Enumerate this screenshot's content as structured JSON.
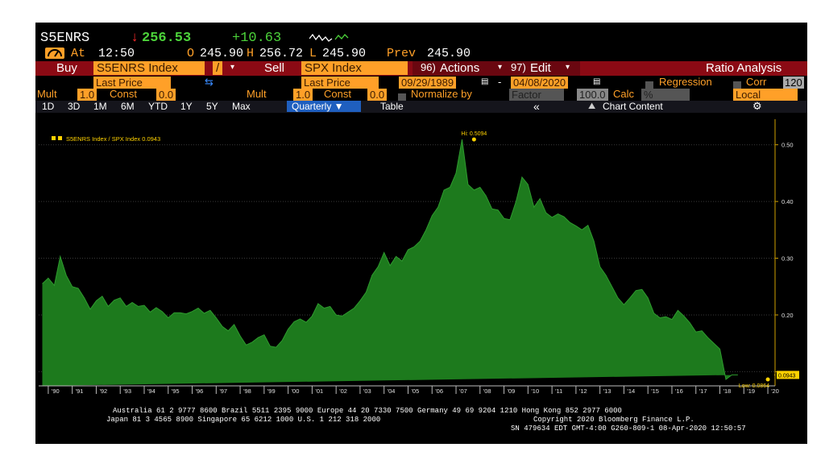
{
  "header": {
    "ticker": "S5ENRS",
    "arrow": "↓",
    "price": "256.53",
    "change": "+10.63",
    "icon_name": "bloomberg-icon",
    "at_label": "At",
    "time": "12:50",
    "open_label": "O",
    "open": "245.90",
    "high_label": "H",
    "high": "256.72",
    "low_label": "L",
    "low": "245.90",
    "prev_label": "Prev",
    "prev": "245.90"
  },
  "toolbar": {
    "buy_label": "Buy",
    "buy_security": "S5ENRS Index",
    "operator": "/",
    "sell_label": "Sell",
    "sell_security": "SPX Index",
    "actions_num": "96)",
    "actions_label": "Actions",
    "edit_num": "97)",
    "edit_label": "Edit",
    "title": "Ratio Analysis"
  },
  "params": {
    "buy_field": "Last Price",
    "sell_field": "Last Price",
    "start_date": "09/29/1989",
    "date_sep": "-",
    "end_date": "04/08/2020",
    "regression_label": "Regression",
    "corr_label": "Corr",
    "corr_value": "120",
    "mult_label": "Mult",
    "mult1": "1.0",
    "const_label": "Const",
    "const1": "0.0",
    "mult2": "1.0",
    "const2": "0.0",
    "normalize_label": "Normalize by",
    "normalize_value": "Factor",
    "factor_value": "100.0",
    "calc_label": "Calc",
    "calc_value": "%",
    "tz_value": "Local"
  },
  "periods": {
    "items": [
      "1D",
      "3D",
      "1M",
      "6M",
      "YTD",
      "1Y",
      "5Y",
      "Max"
    ],
    "active": "Quarterly ▼",
    "table": "Table",
    "collapse": "«",
    "chart_content": "Chart Content",
    "settings_icon": "gear-icon"
  },
  "chart_data": {
    "type": "area",
    "series": [
      {
        "name": "S5ENRS Index / SPX Index 0.0943",
        "color": "#ffd200",
        "fill": "#1d7a1d"
      }
    ],
    "x": [
      1989.75,
      1990.0,
      1990.25,
      1990.5,
      1990.75,
      1991.0,
      1991.25,
      1991.5,
      1991.75,
      1992.0,
      1992.25,
      1992.5,
      1992.75,
      1993.0,
      1993.25,
      1993.5,
      1993.75,
      1994.0,
      1994.25,
      1994.5,
      1994.75,
      1995.0,
      1995.25,
      1995.5,
      1995.75,
      1996.0,
      1996.25,
      1996.5,
      1996.75,
      1997.0,
      1997.25,
      1997.5,
      1997.75,
      1998.0,
      1998.25,
      1998.5,
      1998.75,
      1999.0,
      1999.25,
      1999.5,
      1999.75,
      2000.0,
      2000.25,
      2000.5,
      2000.75,
      2001.0,
      2001.25,
      2001.5,
      2001.75,
      2002.0,
      2002.25,
      2002.5,
      2002.75,
      2003.0,
      2003.25,
      2003.5,
      2003.75,
      2004.0,
      2004.25,
      2004.5,
      2004.75,
      2005.0,
      2005.25,
      2005.5,
      2005.75,
      2006.0,
      2006.25,
      2006.5,
      2006.75,
      2007.0,
      2007.25,
      2007.5,
      2007.75,
      2008.0,
      2008.25,
      2008.5,
      2008.75,
      2009.0,
      2009.25,
      2009.5,
      2009.75,
      2010.0,
      2010.25,
      2010.5,
      2010.75,
      2011.0,
      2011.25,
      2011.5,
      2011.75,
      2012.0,
      2012.25,
      2012.5,
      2012.75,
      2013.0,
      2013.25,
      2013.5,
      2013.75,
      2014.0,
      2014.25,
      2014.5,
      2014.75,
      2015.0,
      2015.25,
      2015.5,
      2015.75,
      2016.0,
      2016.25,
      2016.5,
      2016.75,
      2017.0,
      2017.25,
      2017.5,
      2017.75,
      2018.0,
      2018.25,
      2018.5,
      2018.75,
      2019.0,
      2019.25,
      2019.5,
      2019.75,
      2020.0,
      2020.15,
      2020.27
    ],
    "values": [
      0.255,
      0.265,
      0.252,
      0.303,
      0.27,
      0.25,
      0.247,
      0.23,
      0.21,
      0.225,
      0.233,
      0.215,
      0.226,
      0.23,
      0.215,
      0.222,
      0.215,
      0.217,
      0.205,
      0.213,
      0.206,
      0.195,
      0.204,
      0.204,
      0.202,
      0.206,
      0.212,
      0.203,
      0.208,
      0.195,
      0.18,
      0.172,
      0.183,
      0.163,
      0.147,
      0.152,
      0.16,
      0.165,
      0.145,
      0.143,
      0.155,
      0.175,
      0.188,
      0.193,
      0.187,
      0.198,
      0.22,
      0.212,
      0.215,
      0.2,
      0.198,
      0.205,
      0.212,
      0.225,
      0.24,
      0.27,
      0.285,
      0.31,
      0.287,
      0.303,
      0.295,
      0.315,
      0.32,
      0.33,
      0.35,
      0.375,
      0.39,
      0.42,
      0.425,
      0.45,
      0.5094,
      0.43,
      0.42,
      0.425,
      0.41,
      0.387,
      0.385,
      0.37,
      0.368,
      0.4,
      0.443,
      0.43,
      0.39,
      0.405,
      0.38,
      0.372,
      0.378,
      0.373,
      0.363,
      0.357,
      0.35,
      0.358,
      0.33,
      0.285,
      0.27,
      0.25,
      0.23,
      0.218,
      0.23,
      0.243,
      0.245,
      0.23,
      0.203,
      0.195,
      0.197,
      0.192,
      0.208,
      0.198,
      0.186,
      0.17,
      0.172,
      0.16,
      0.15,
      0.14,
      0.0864,
      0.0943,
      0.0943
    ],
    "xlim": [
      1989.6,
      2020.3
    ],
    "ylim": [
      0.075,
      0.545
    ],
    "y_ticks": [
      0.1,
      0.2,
      0.3,
      0.4,
      0.5
    ],
    "y_tick_labels": [
      "",
      "0.20",
      "0.30",
      "0.40",
      "0.50"
    ],
    "x_tick_labels": [
      "'90",
      "'91",
      "'92",
      "'93",
      "'94",
      "'95",
      "'96",
      "'97",
      "'98",
      "'99",
      "'00",
      "'01",
      "'02",
      "'03",
      "'04",
      "'05",
      "'06",
      "'07",
      "'08",
      "'09",
      "'10",
      "'11",
      "'12",
      "'13",
      "'14",
      "'15",
      "'16",
      "'17",
      "'18",
      "'19",
      "'20"
    ],
    "high_annotation": "Hi: 0.5094",
    "high_x": 2007.75,
    "high_value": 0.5094,
    "low_annotation": "Low: 0.0864",
    "low_x": 2020.0,
    "low_value": 0.0864,
    "last_label": "0.0943",
    "last_value": 0.0943,
    "grid": true,
    "legend_position": "top-left"
  },
  "footer": {
    "line1": "Australia 61 2 9777 8600 Brazil 5511 2395 9000 Europe 44 20 7330 7500 Germany 49 69 9204 1210 Hong Kong 852 2977 6000",
    "line2a": "Japan 81 3 4565 8900       Singapore 65 6212 1000       U.S. 1 212 318 2000",
    "line2b": "Copyright 2020 Bloomberg Finance L.P.",
    "line3": "SN 479634 EDT  GMT-4:00 G260-809-1 08-Apr-2020 12:50:57"
  }
}
